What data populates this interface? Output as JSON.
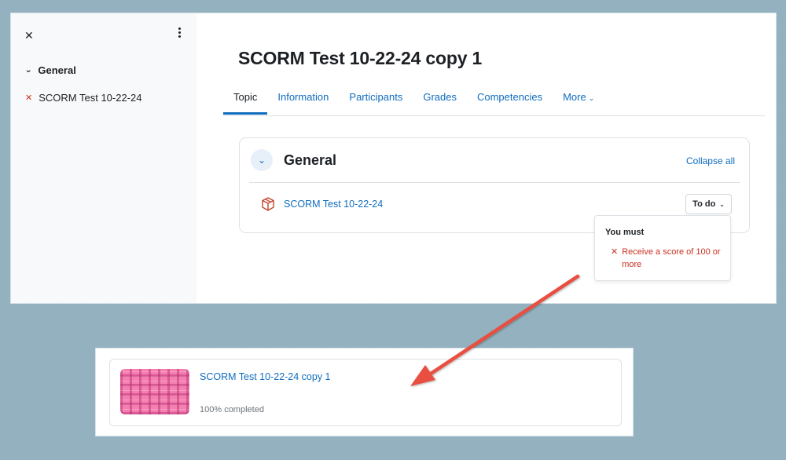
{
  "drawer": {
    "close_glyph": "✕",
    "section_label": "General",
    "items": [
      {
        "label": "SCORM Test 10-22-24",
        "status_glyph": "✕"
      }
    ]
  },
  "course": {
    "title": "SCORM Test 10-22-24 copy 1",
    "tabs": [
      {
        "label": "Topic"
      },
      {
        "label": "Information"
      },
      {
        "label": "Participants"
      },
      {
        "label": "Grades"
      },
      {
        "label": "Competencies"
      },
      {
        "label": "More"
      }
    ]
  },
  "section": {
    "title": "General",
    "collapse_label": "Collapse all",
    "activity": {
      "name": "SCORM Test 10-22-24",
      "completion_button": "To do"
    },
    "popover": {
      "title": "You must",
      "requirement_glyph": "✕",
      "requirement": "Receive a score of 100 or more"
    }
  },
  "course_card": {
    "title": "SCORM Test 10-22-24 copy 1",
    "progress_text": "100% completed",
    "progress_percent": 100
  },
  "colors": {
    "link": "#0f6cbf",
    "error": "#ca3120",
    "arrow": "#e8503f",
    "background": "#94b1c0"
  },
  "icons": {
    "drawer_close": "close-icon",
    "drawer_menu": "kebab-icon",
    "section_toggle": "chevron-down-icon",
    "activity": "scorm-package-icon",
    "annotation": "arrow-annotation"
  }
}
